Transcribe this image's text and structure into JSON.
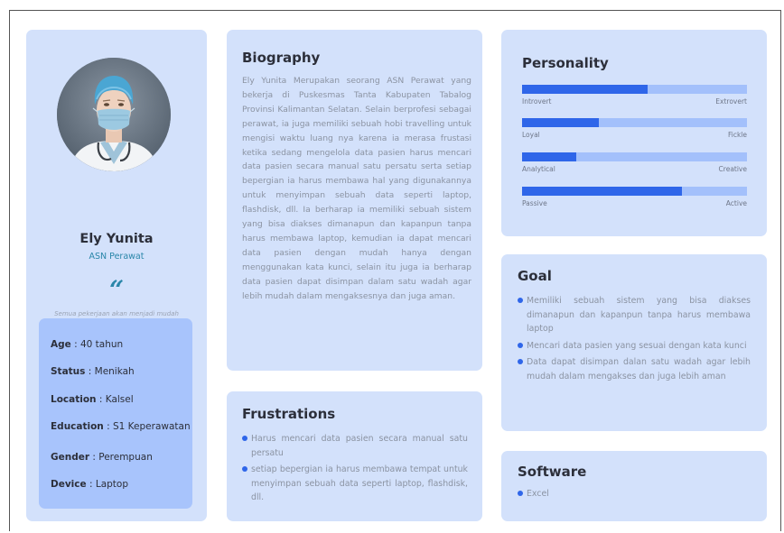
{
  "profile": {
    "name": "Ely Yunita",
    "role": "ASN Perawat",
    "quote_mark": "“",
    "quote": "Semua pekerjaan akan menjadi mudah jika dianggap mudah",
    "info": [
      {
        "label": "Age",
        "value": " : 40 tahun"
      },
      {
        "label": "Status",
        "value": " : Menikah"
      },
      {
        "label": "Location",
        "value": " : Kalsel"
      },
      {
        "label": "Education",
        "value": " : S1 Keperawatan"
      },
      {
        "label": "Gender",
        "value": " : Perempuan"
      },
      {
        "label": "Device",
        "value": " : Laptop"
      }
    ]
  },
  "biography": {
    "title": "Biography",
    "text": "Ely Yunita Merupakan seorang ASN Perawat yang bekerja di Puskesmas Tanta Kabupaten Tabalog Provinsi Kalimantan Selatan. Selain berprofesi sebagai perawat, ia juga memiliki sebuah hobi travelling untuk mengisi waktu luang nya karena ia merasa frustasi ketika sedang mengelola data pasien harus mencari data pasien secara manual satu persatu serta setiap bepergian ia harus membawa hal yang digunakannya untuk menyimpan sebuah data seperti laptop, flashdisk, dll. Ia berharap ia memiliki sebuah sistem yang bisa diakses dimanapun dan kapanpun tanpa harus membawa laptop, kemudian ia dapat mencari data pasien dengan mudah hanya dengan menggunakan kata kunci, selain itu juga ia berharap data pasien dapat disimpan dalam satu wadah agar lebih mudah dalam mengaksesnya dan juga aman."
  },
  "frustrations": {
    "title": "Frustrations",
    "items": [
      "Harus mencari data pasien secara manual satu persatu",
      "setiap bepergian ia harus membawa tempat untuk menyimpan sebuah data seperti laptop, flashdisk, dll."
    ]
  },
  "personality": {
    "title": "Personality",
    "traits": [
      {
        "left": "Introvert",
        "right": "Extrovert",
        "value": 0.56
      },
      {
        "left": "Loyal",
        "right": "Fickle",
        "value": 0.34
      },
      {
        "left": "Analytical",
        "right": "Creative",
        "value": 0.24
      },
      {
        "left": "Passive",
        "right": "Active",
        "value": 0.71
      }
    ],
    "colors": {
      "fill": "#2f66e9",
      "track": "#a3c0fb"
    }
  },
  "goal": {
    "title": "Goal",
    "items": [
      "Memiliki sebuah sistem yang bisa diakses dimanapun dan kapanpun tanpa harus membawa laptop",
      "Mencari data pasien yang sesuai dengan kata kunci",
      "Data dapat disimpan dalan satu wadah agar lebih mudah dalam mengakses dan juga lebih aman"
    ]
  },
  "software": {
    "title": "Software",
    "items": [
      "Excel"
    ]
  }
}
